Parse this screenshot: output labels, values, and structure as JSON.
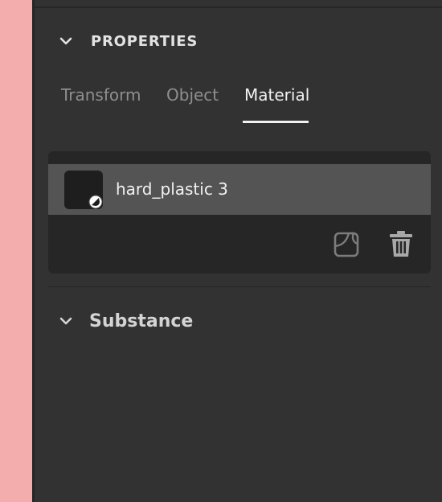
{
  "properties": {
    "title": "PROPERTIES",
    "tabs": [
      {
        "label": "Transform",
        "active": false
      },
      {
        "label": "Object",
        "active": false
      },
      {
        "label": "Material",
        "active": true
      }
    ]
  },
  "material": {
    "name": "hard_plastic 3",
    "swatch_color": "#1e1e1e"
  },
  "substance": {
    "title": "Substance"
  },
  "icons": {
    "collapse": "chevron-down-icon",
    "replace": "material-swap-icon",
    "delete": "trash-icon"
  },
  "colors": {
    "panel_bg": "#323232",
    "card_bg": "#262626",
    "selected_row": "#545454",
    "canvas_bg": "#f3adad"
  }
}
